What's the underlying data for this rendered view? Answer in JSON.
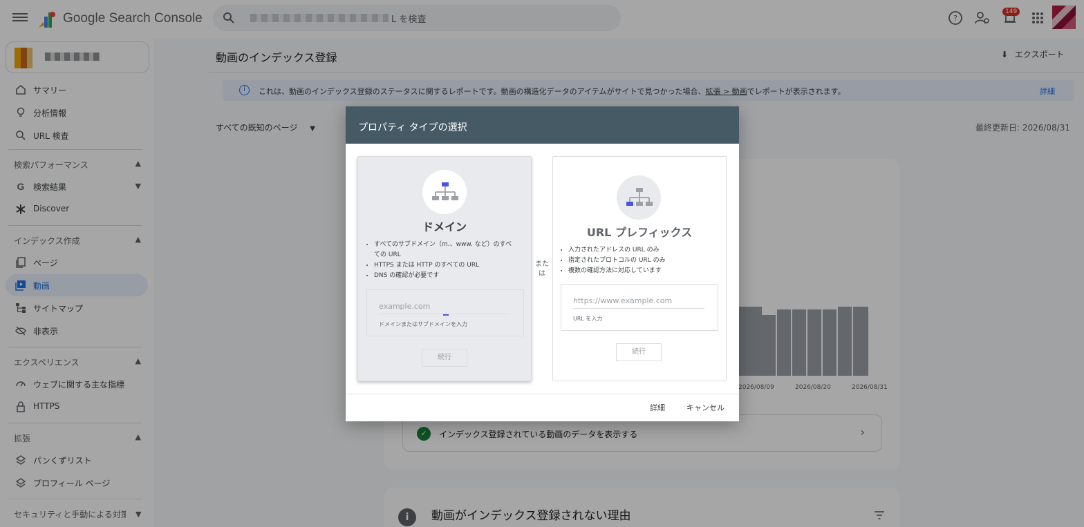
{
  "app": {
    "title": "Google Search Console"
  },
  "search": {
    "placeholder": "L を検査"
  },
  "notifications": {
    "count": "149"
  },
  "sidebar": {
    "items": [
      {
        "label": "サマリー",
        "icon": "home-icon"
      },
      {
        "label": "分析情報",
        "icon": "lightbulb-icon"
      },
      {
        "label": "URL 検査",
        "icon": "search-icon"
      }
    ],
    "sections": [
      {
        "title": "検索パフォーマンス",
        "items": [
          {
            "label": "検索結果",
            "icon": "google-g-icon"
          },
          {
            "label": "Discover",
            "icon": "asterisk-icon"
          }
        ]
      },
      {
        "title": "インデックス作成",
        "items": [
          {
            "label": "ページ",
            "icon": "pages-icon"
          },
          {
            "label": "動画",
            "icon": "video-icon"
          },
          {
            "label": "サイトマップ",
            "icon": "sitemap-icon"
          },
          {
            "label": "非表示",
            "icon": "hidden-icon"
          }
        ]
      },
      {
        "title": "エクスペリエンス",
        "items": [
          {
            "label": "ウェブに関する主な指標",
            "icon": "gauge-icon"
          },
          {
            "label": "HTTPS",
            "icon": "lock-icon"
          }
        ]
      },
      {
        "title": "拡張",
        "items": [
          {
            "label": "パンくずリスト",
            "icon": "layers-icon"
          },
          {
            "label": "プロフィール ページ",
            "icon": "layers-icon"
          }
        ]
      },
      {
        "title": "セキュリティと手動による対策",
        "items": []
      }
    ]
  },
  "main": {
    "title": "動画のインデックス登録",
    "export_label": "エクスポート",
    "banner": {
      "text": "これは、動画のインデックス登録のステータスに関するレポートです。動画の構造化データのアイテムがサイトで見つかった場合、",
      "link": "拡張 > 動画",
      "suffix": "でレポートが表示されます。",
      "more": "詳細"
    },
    "filter_label": "すべての既知のページ",
    "updated": "最終更新日: 2026/08/31",
    "chart_ticks": [
      "2026/08/09",
      "2026/08/20",
      "2026/08/31"
    ],
    "indexed_row": "インデックス登録されている動画のデータを表示する",
    "not_indexed_title": "動画がインデックス登録されない理由"
  },
  "dialog": {
    "title": "プロパティ タイプの選択",
    "or_label": "または",
    "domain": {
      "name": "ドメイン",
      "bullets": [
        "すべてのサブドメイン（m.、www. など）のすべての URL",
        "HTTPS または HTTP のすべての URL",
        "DNS の確認が必要です"
      ],
      "input_placeholder": "example.com",
      "input_hint": "ドメインまたはサブドメインを入力",
      "continue": "続行"
    },
    "prefix": {
      "name": "URL プレフィックス",
      "bullets": [
        "入力されたアドレスの URL のみ",
        "指定されたプロトコルの URL のみ",
        "複数の確認方法に対応しています"
      ],
      "input_placeholder": "https://www.example.com",
      "input_hint": "URL を入力",
      "continue": "続行"
    },
    "learn_more": "詳細",
    "cancel": "キャンセル"
  }
}
